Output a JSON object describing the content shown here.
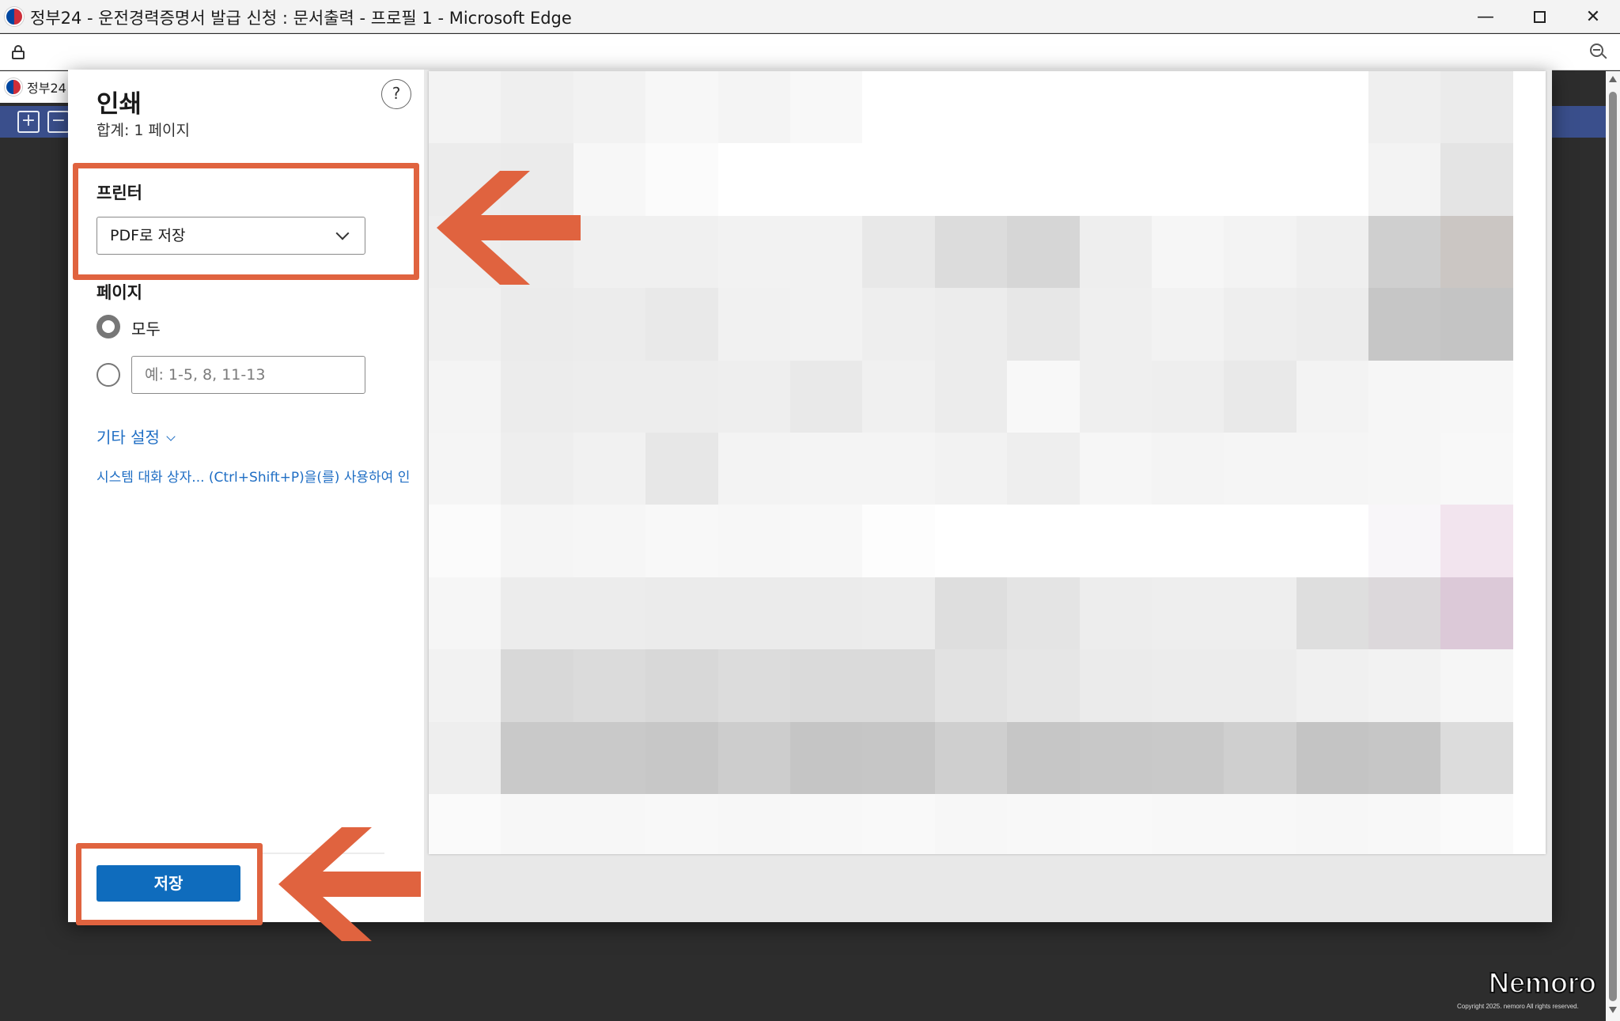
{
  "window": {
    "title": "정부24 - 운전경력증명서 발급 신청 : 문서출력 - 프로필 1 - Microsoft Edge",
    "min_glyph": "—",
    "close_glyph": "✕"
  },
  "page": {
    "tab_label": "정부24"
  },
  "print": {
    "title": "인쇄",
    "total": "합계: 1 페이지",
    "help": "?",
    "printer_label": "프린터",
    "printer_value": "PDF로 저장",
    "pages_label": "페이지",
    "pages_all": "모두",
    "pages_placeholder": "예: 1-5, 8, 11-13",
    "more_settings": "기타 설정",
    "system_dialog": "시스템 대화 상자... (Ctrl+Shift+P)을(를) 사용하여 인",
    "save_button": "저장"
  },
  "watermark": {
    "brand": "Nemoro",
    "copyright": "Copyright 2025. nemoro All rights reserved."
  },
  "colors": {
    "accent_blue": "#0f6cbd",
    "annotation_orange": "#e0633f",
    "page_header_blue": "#3a4f8c"
  }
}
